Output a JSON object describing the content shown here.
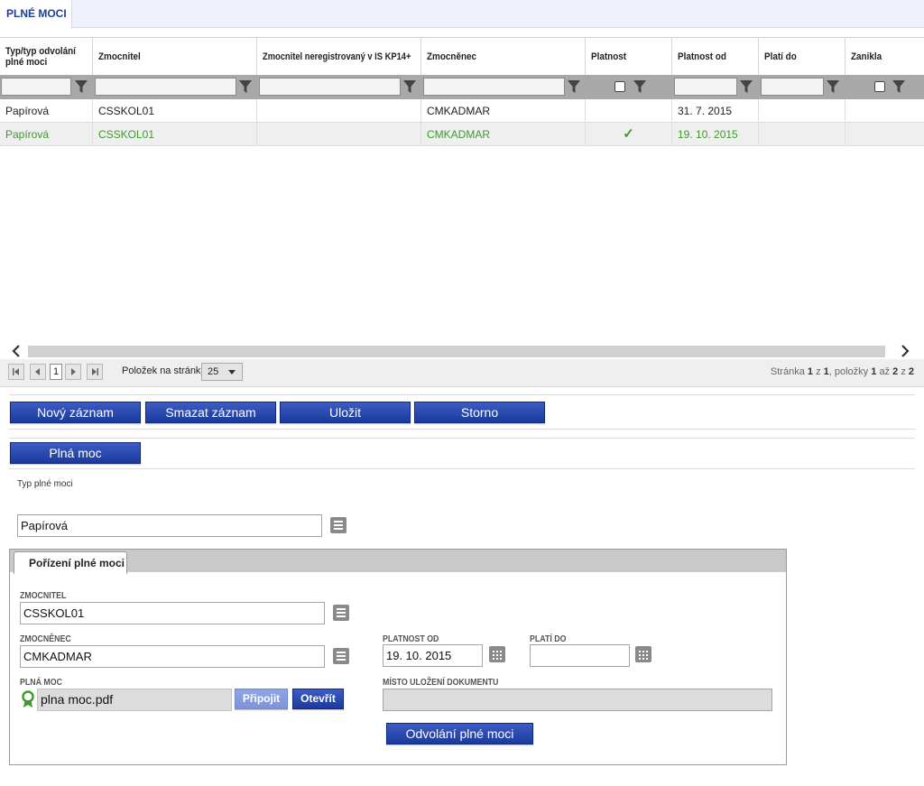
{
  "top_tab": {
    "label": "PLNÉ MOCI"
  },
  "grid": {
    "columns": [
      "Typ/typ odvolání plné moci",
      "Zmocnitel",
      "Zmocnitel neregistrovaný v IS KP14+",
      "Zmocněnec",
      "Platnost",
      "Platnost od",
      "Platí do",
      "Zanikla"
    ],
    "rows": [
      {
        "typ": "Papírová",
        "zmocnitel": "CSSKOL01",
        "zmocnitel_nereg": "",
        "zmocnenec": "CMKADMAR",
        "platnost": "",
        "platnost_od": "31. 7. 2015",
        "plati_do": "",
        "zanikla": ""
      },
      {
        "typ": "Papírová",
        "zmocnitel": "CSSKOL01",
        "zmocnitel_nereg": "",
        "zmocnenec": "CMKADMAR",
        "platnost": "✓",
        "platnost_od": "19. 10. 2015",
        "plati_do": "",
        "zanikla": ""
      }
    ],
    "selected_row_color": "#3f9a2c"
  },
  "pager": {
    "current_page": "1",
    "per_page_label": "Položek na stránku",
    "per_page_value": "25",
    "info_prefix": "Stránka",
    "page": "1",
    "of": "z",
    "pages": "1",
    "items_label": ", položky",
    "range_start": "1",
    "to": "až",
    "range_end": "2",
    "total": "2"
  },
  "toolbar": {
    "new_label": "Nový záznam",
    "delete_label": "Smazat záznam",
    "save_label": "Uložit",
    "cancel_label": "Storno"
  },
  "section_button": {
    "label": "Plná moc"
  },
  "form": {
    "typ_label": "Typ plné moci",
    "typ_value": "Papírová",
    "tab_label": "Pořízení plné moci",
    "zmocnitel_label": "ZMOCNITEL",
    "zmocnitel_value": "CSSKOL01",
    "zmocnenec_label": "ZMOCNĚNEC",
    "zmocnenec_value": "CMKADMAR",
    "platnost_od_label": "PLATNOST OD",
    "platnost_od_value": "19. 10. 2015",
    "plati_do_label": "PLATÍ DO",
    "plati_do_value": "",
    "plna_moc_label": "PLNÁ MOC",
    "plna_moc_file": "plna moc.pdf",
    "pripojit_label": "Připojit",
    "otevrit_label": "Otevřít",
    "misto_label": "MÍSTO ULOŽENÍ DOKUMENTU",
    "misto_value": "",
    "revoke_label": "Odvolání plné moci"
  },
  "colors": {
    "accent": "#1b3a9c",
    "tab_text": "#1e3f93",
    "valid": "#3f9a2c"
  }
}
